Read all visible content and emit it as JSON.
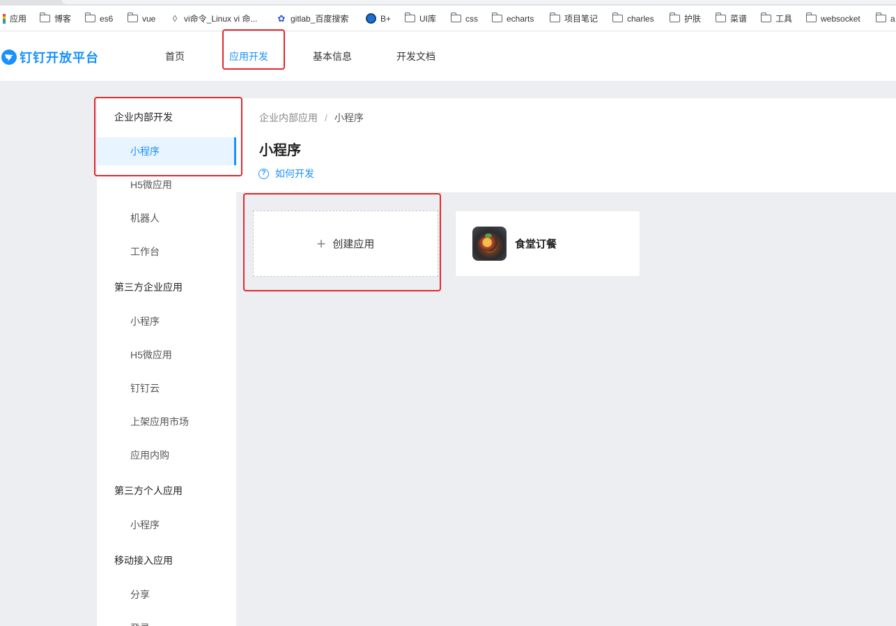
{
  "bookmarks": [
    {
      "label": "应用",
      "icon": "apps-icon"
    },
    {
      "label": "博客",
      "icon": "folder-icon"
    },
    {
      "label": "es6",
      "icon": "folder-icon"
    },
    {
      "label": "vue",
      "icon": "folder-icon"
    },
    {
      "label": "vi命令_Linux vi 命...",
      "icon": "vi-icon"
    },
    {
      "label": "gitlab_百度搜索",
      "icon": "baidu-paw-icon"
    },
    {
      "label": "B+",
      "icon": "bplus-icon"
    },
    {
      "label": "UI库",
      "icon": "folder-icon"
    },
    {
      "label": "css",
      "icon": "folder-icon"
    },
    {
      "label": "echarts",
      "icon": "folder-icon"
    },
    {
      "label": "项目笔记",
      "icon": "folder-icon"
    },
    {
      "label": "charles",
      "icon": "folder-icon"
    },
    {
      "label": "护肤",
      "icon": "folder-icon"
    },
    {
      "label": "菜谱",
      "icon": "folder-icon"
    },
    {
      "label": "工具",
      "icon": "folder-icon"
    },
    {
      "label": "websocket",
      "icon": "folder-icon"
    },
    {
      "label": "a",
      "icon": "folder-icon"
    }
  ],
  "header": {
    "logo_text": "钉钉开放平台",
    "nav": [
      {
        "label": "首页"
      },
      {
        "label": "应用开发",
        "active": true
      },
      {
        "label": "基本信息"
      },
      {
        "label": "开发文档"
      }
    ]
  },
  "sidebar": {
    "groups": [
      {
        "title": "企业内部开发",
        "items": [
          "小程序",
          "H5微应用",
          "机器人",
          "工作台"
        ]
      },
      {
        "title": "第三方企业应用",
        "items": [
          "小程序",
          "H5微应用",
          "钉钉云",
          "上架应用市场",
          "应用内购"
        ]
      },
      {
        "title": "第三方个人应用",
        "items": [
          "小程序"
        ]
      },
      {
        "title": "移动接入应用",
        "items": [
          "分享",
          "登录"
        ]
      }
    ],
    "active_item": "企业内部开发/小程序"
  },
  "page": {
    "breadcrumb": [
      "企业内部应用",
      "小程序"
    ],
    "breadcrumb_sep": "/",
    "title": "小程序",
    "help_link": "如何开发"
  },
  "cards": {
    "create_label": "创建应用",
    "create_icon": "plus-icon",
    "apps": [
      {
        "name": "食堂订餐",
        "icon": "food-thumbnail"
      }
    ]
  },
  "colors": {
    "accent": "#1890ff",
    "highlight_box": "#e5262c",
    "background": "#edeef1"
  }
}
